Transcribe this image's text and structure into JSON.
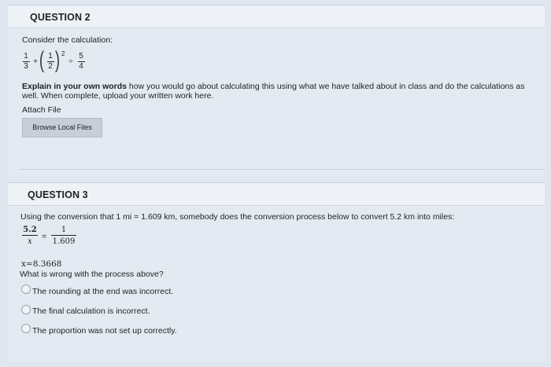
{
  "q2": {
    "title": "QUESTION 2",
    "intro": "Consider the calculation:",
    "expression": {
      "f1_num": "1",
      "f1_den": "3",
      "plus": "+",
      "f2_num": "1",
      "f2_den": "2",
      "exponent": "2",
      "divide": "÷",
      "f3_num": "5",
      "f3_den": "4"
    },
    "instruction_bold": "Explain in your own words",
    "instruction_rest": " how you would go about calculating this using what we have talked about in class and do the calculations as",
    "instruction_line2": "well. When complete, upload your written work here.",
    "attach_label": "Attach File",
    "browse_button": "Browse Local Files"
  },
  "q3": {
    "title": "QUESTION 3",
    "prompt": "Using the conversion that 1 mi = 1.609 km, somebody does the conversion process below to convert 5.2 km into miles:",
    "eq": {
      "left_num": "5.2",
      "left_den": "x",
      "equals": "=",
      "right_num": "1",
      "right_den": "1.609"
    },
    "result": "x=8.3668",
    "question": "What is wrong with the process above?",
    "options": [
      "The rounding at the end was incorrect.",
      "The final calculation is incorrect.",
      "The proportion was not set up correctly."
    ]
  }
}
